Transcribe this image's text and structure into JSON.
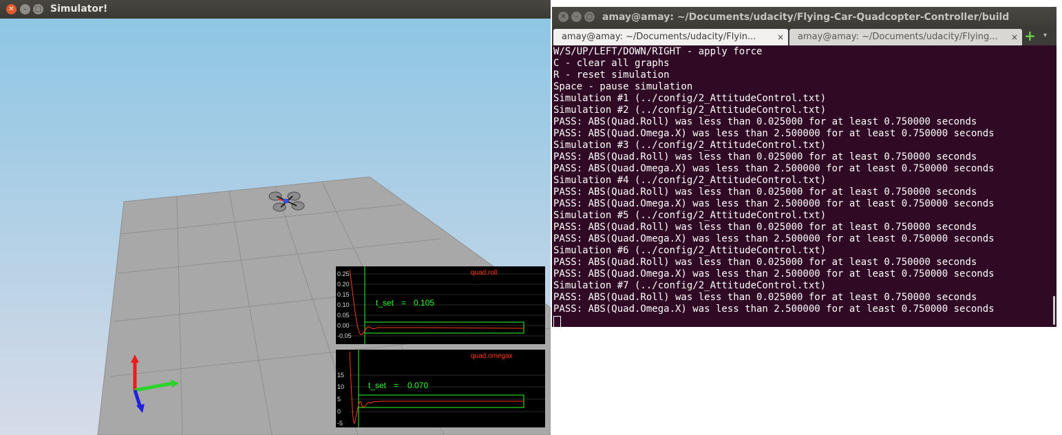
{
  "simulator": {
    "title": "Simulator!",
    "graphs": [
      {
        "name": "quad.roll",
        "tset_label": "t_set",
        "tset_value": "0.105",
        "ticks": [
          "0.25",
          "0.20",
          "0.15",
          "0.10",
          "0.05",
          "0.00",
          "-0.05"
        ]
      },
      {
        "name": "quad.omegax",
        "tset_label": "t_set",
        "tset_value": "0.070",
        "ticks": [
          "15",
          "10",
          "5",
          "0",
          "-5"
        ]
      }
    ],
    "colors": {
      "sky": "#9cc9e2",
      "floor": "#a9a9a9",
      "graph_bg": "#000000",
      "trace": "#ff3b16",
      "threshold": "#2aff2a"
    }
  },
  "terminal": {
    "title": "amay@amay: ~/Documents/udacity/Flying-Car-Quadcopter-Controller/build",
    "tabs": [
      {
        "label": "amay@amay: ~/Documents/udacity/Flyin...",
        "active": true
      },
      {
        "label": "amay@amay: ~/Documents/udacity/Flying...",
        "active": false
      }
    ],
    "close_glyph": "×",
    "add_glyph": "+",
    "menu_glyph": "▾",
    "lines": [
      "W/S/UP/LEFT/DOWN/RIGHT - apply force",
      "C - clear all graphs",
      "R - reset simulation",
      "Space - pause simulation",
      "Simulation #1 (../config/2_AttitudeControl.txt)",
      "Simulation #2 (../config/2_AttitudeControl.txt)",
      "PASS: ABS(Quad.Roll) was less than 0.025000 for at least 0.750000 seconds",
      "PASS: ABS(Quad.Omega.X) was less than 2.500000 for at least 0.750000 seconds",
      "Simulation #3 (../config/2_AttitudeControl.txt)",
      "PASS: ABS(Quad.Roll) was less than 0.025000 for at least 0.750000 seconds",
      "PASS: ABS(Quad.Omega.X) was less than 2.500000 for at least 0.750000 seconds",
      "Simulation #4 (../config/2_AttitudeControl.txt)",
      "PASS: ABS(Quad.Roll) was less than 0.025000 for at least 0.750000 seconds",
      "PASS: ABS(Quad.Omega.X) was less than 2.500000 for at least 0.750000 seconds",
      "Simulation #5 (../config/2_AttitudeControl.txt)",
      "PASS: ABS(Quad.Roll) was less than 0.025000 for at least 0.750000 seconds",
      "PASS: ABS(Quad.Omega.X) was less than 2.500000 for at least 0.750000 seconds",
      "Simulation #6 (../config/2_AttitudeControl.txt)",
      "PASS: ABS(Quad.Roll) was less than 0.025000 for at least 0.750000 seconds",
      "PASS: ABS(Quad.Omega.X) was less than 2.500000 for at least 0.750000 seconds",
      "Simulation #7 (../config/2_AttitudeControl.txt)",
      "PASS: ABS(Quad.Roll) was less than 0.025000 for at least 0.750000 seconds",
      "PASS: ABS(Quad.Omega.X) was less than 2.500000 for at least 0.750000 seconds"
    ],
    "colors": {
      "background": "#300a24",
      "text": "#ffffff"
    }
  }
}
